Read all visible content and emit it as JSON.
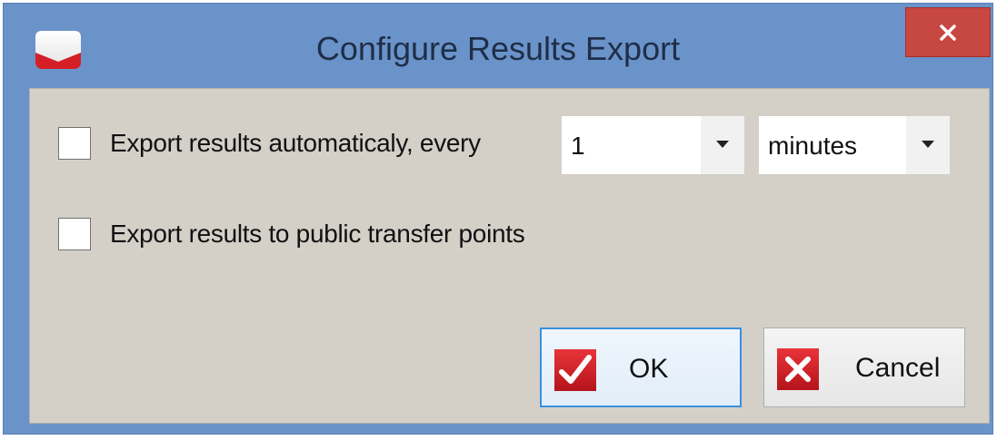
{
  "window": {
    "title": "Configure Results Export",
    "close_glyph": "✕",
    "app_icon": "red-envelope-icon"
  },
  "options": {
    "auto_export": {
      "checked": false,
      "label": "Export results automaticaly, every",
      "interval_value": "1",
      "unit_value": "minutes"
    },
    "public_transfer": {
      "checked": false,
      "label": "Export results to public transfer points"
    }
  },
  "buttons": {
    "ok": {
      "label": "OK",
      "icon": "checkmark-icon"
    },
    "cancel": {
      "label": "Cancel",
      "icon": "x-icon"
    }
  },
  "colors": {
    "titlebar": "#6a93c9",
    "client": "#d4d0c8",
    "close_button": "#c74741",
    "icon_red": "#d51f26"
  }
}
